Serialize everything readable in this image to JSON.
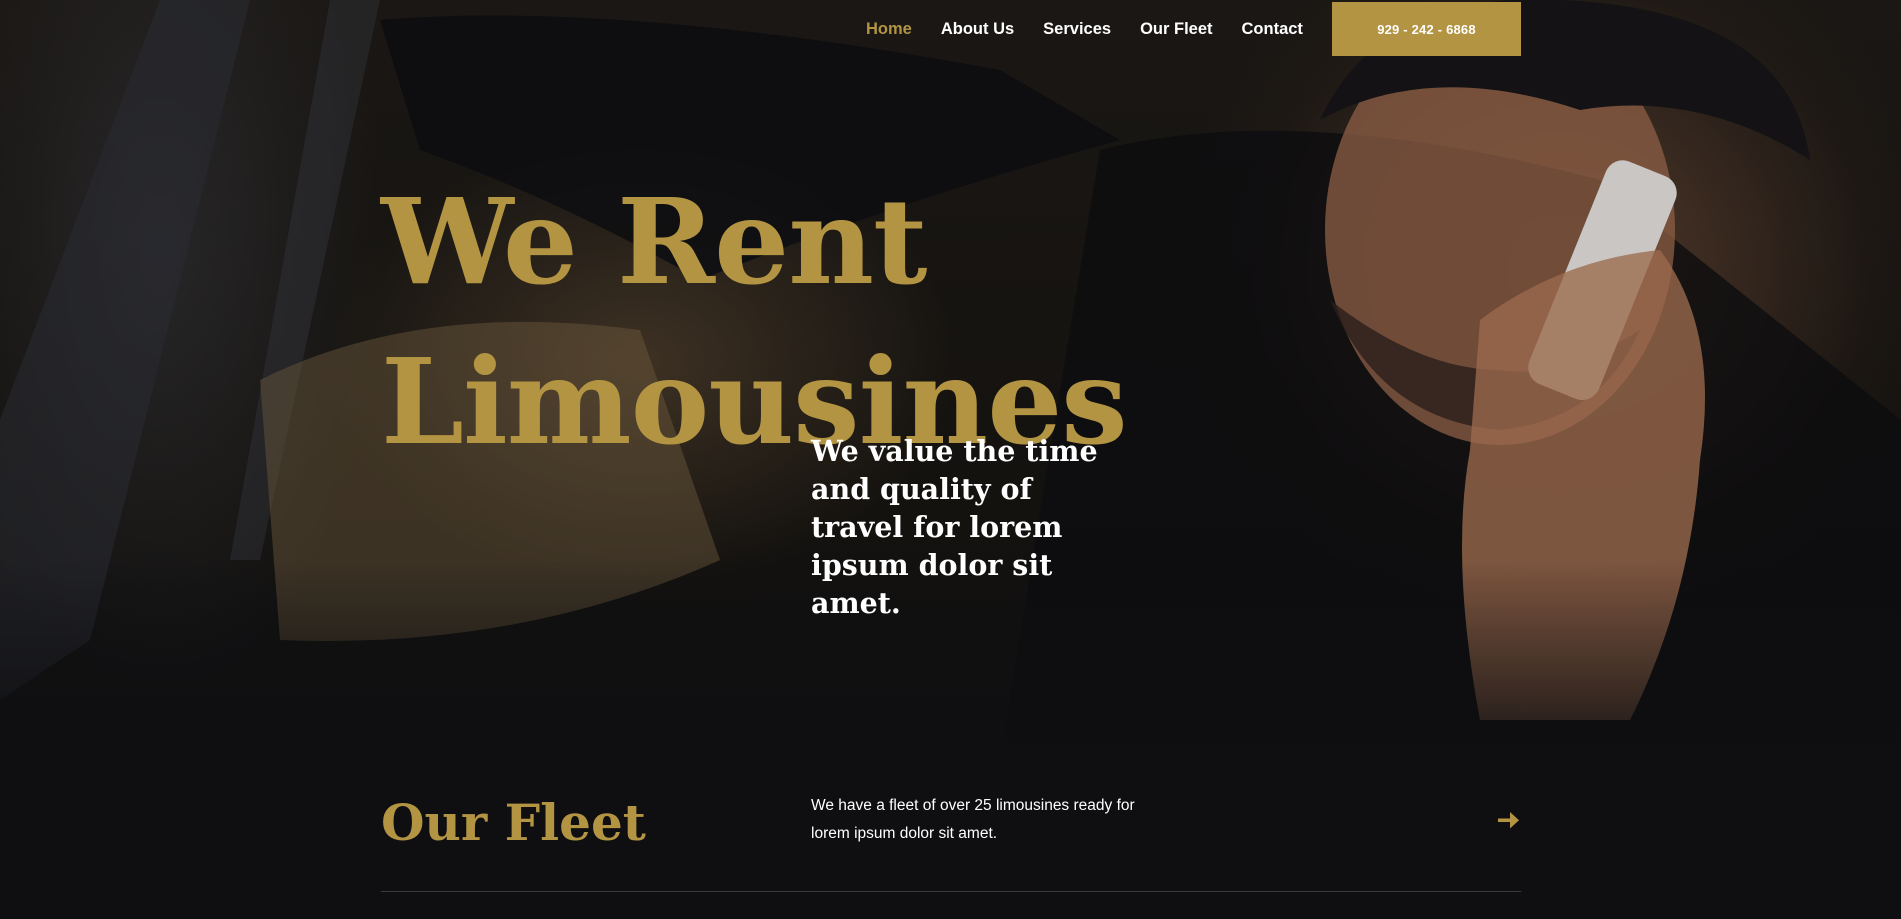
{
  "nav": {
    "items": [
      {
        "label": "Home",
        "active": true
      },
      {
        "label": "About Us",
        "active": false
      },
      {
        "label": "Services",
        "active": false
      },
      {
        "label": "Our Fleet",
        "active": false
      },
      {
        "label": "Contact",
        "active": false
      }
    ],
    "phone": "929 - 242 - 6868"
  },
  "hero": {
    "title_line1": "We Rent",
    "title_line2": "Limousines",
    "subtitle": "We value the time and quality of travel for lorem ipsum dolor sit amet."
  },
  "fleet": {
    "title": "Our Fleet",
    "description": "We have a fleet of over 25 limousines ready for lorem ipsum dolor sit amet.",
    "arrow_icon": "arrow-right-icon"
  },
  "colors": {
    "accent": "#b39443",
    "background": "#0f0f11",
    "text": "#ffffff"
  }
}
